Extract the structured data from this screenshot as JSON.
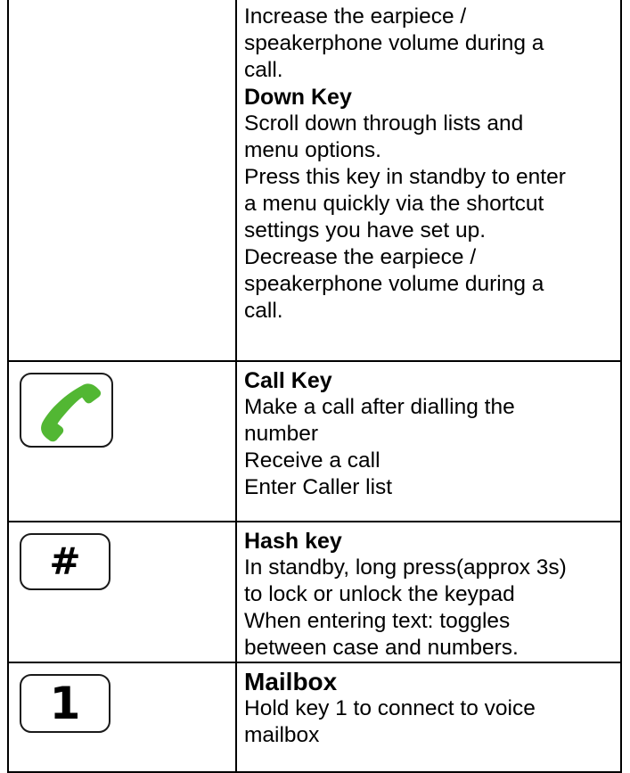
{
  "rows": {
    "nav": {
      "lines": [
        "Increase the earpiece /",
        "speakerphone volume during a",
        "call.",
        "Down Key",
        "Scroll down through lists and",
        "menu options.",
        "Press this key in standby to enter",
        "a menu quickly via the shortcut",
        "settings you have set up.",
        "Decrease the earpiece /",
        "speakerphone volume during a",
        "call."
      ]
    },
    "call": {
      "icon": "phone-handset-icon",
      "title": "Call Key",
      "lines": [
        "Make a call after dialling the",
        "number",
        "Receive a call",
        "Enter Caller list"
      ]
    },
    "hash": {
      "icon": "hash-key-icon",
      "glyph": "#",
      "title": "Hash key",
      "lines": [
        "In standby, long press(approx 3s)",
        "to lock or unlock the keypad",
        "When entering text: toggles",
        "between case and numbers."
      ]
    },
    "mailbox": {
      "icon": "number-one-key-icon",
      "glyph": "1",
      "title": "Mailbox",
      "lines": [
        "Hold key 1 to connect to voice",
        "mailbox"
      ]
    }
  },
  "colors": {
    "handset_green": "#52b733",
    "border": "#000000",
    "text": "#000000"
  }
}
